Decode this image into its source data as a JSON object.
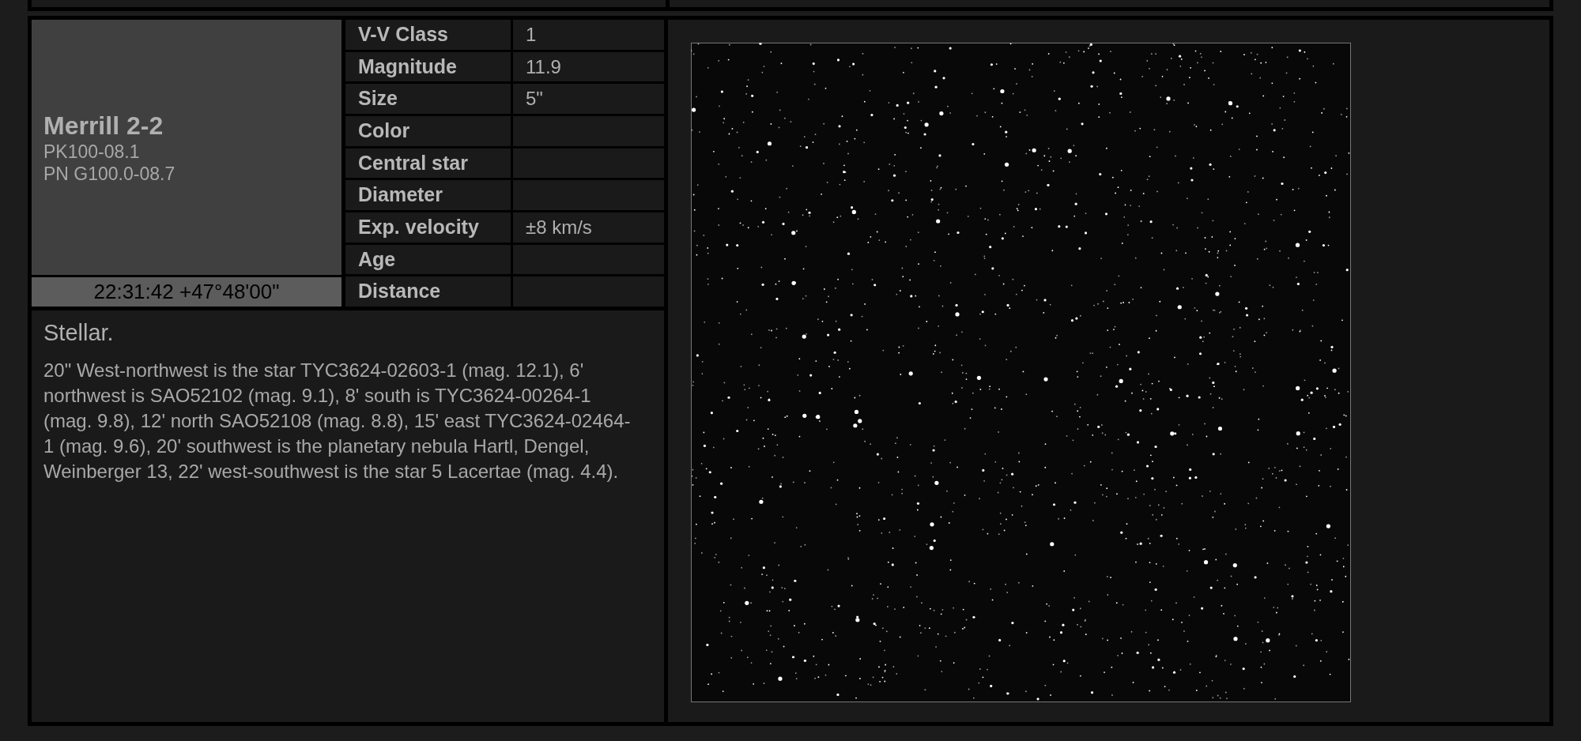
{
  "object": {
    "name": "Merrill 2-2",
    "designations": [
      "PK100-08.1",
      "PN G100.0-08.7"
    ],
    "coordinates": "22:31:42 +47°48'00\""
  },
  "properties": [
    {
      "label": "V-V Class",
      "value": "1"
    },
    {
      "label": "Magnitude",
      "value": "11.9"
    },
    {
      "label": "Size",
      "value": "5\""
    },
    {
      "label": "Color"
    },
    {
      "label": "Central star"
    },
    {
      "label": "Diameter"
    },
    {
      "label": "Exp. velocity",
      "value": "±8 km/s"
    },
    {
      "label": "Age"
    },
    {
      "label": "Distance"
    }
  ],
  "description": {
    "summary": "Stellar.",
    "text": "20\" West-northwest is the star TYC3624-02603-1 (mag. 12.1), 6' northwest is SAO52102 (mag. 9.1), 8' south is TYC3624-00264-1 (mag. 9.8), 12' north SAO52108 (mag. 8.8), 15' east TYC3624-02464-1 (mag. 9.6), 20' southwest is the planetary nebula Hartl, Dengel, Weinberger 13, 22' west-southwest is the star 5 Lacertae (mag. 4.4)."
  }
}
